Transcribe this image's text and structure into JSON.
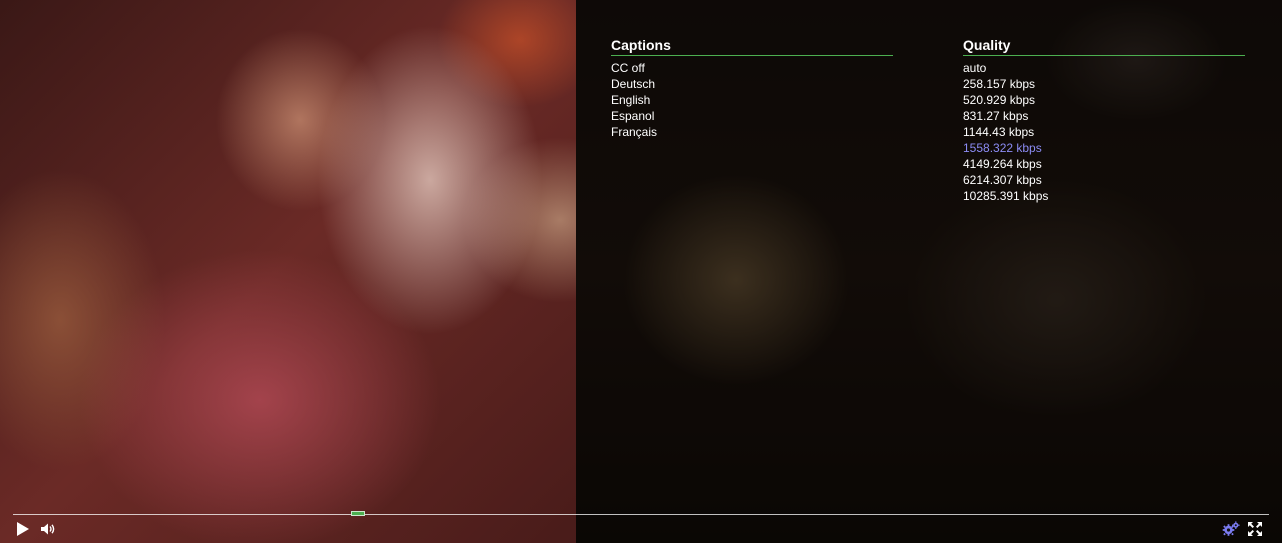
{
  "player": {
    "progress_fraction": 0.275
  },
  "captions": {
    "heading": "Captions",
    "items": [
      "CC off",
      "Deutsch",
      "English",
      "Espanol",
      "Français"
    ]
  },
  "quality": {
    "heading": "Quality",
    "items": [
      "auto",
      "258.157 kbps",
      "520.929 kbps",
      "831.27 kbps",
      "1144.43 kbps",
      "1558.322 kbps",
      "4149.264 kbps",
      "6214.307 kbps",
      "10285.391 kbps"
    ],
    "selected": "1558.322 kbps"
  },
  "controls": {
    "play_icon": "play-icon",
    "volume_icon": "volume-icon",
    "settings_icon": "gear-icon",
    "fullscreen_icon": "fullscreen-icon"
  },
  "colors": {
    "accent_green": "#4caf50",
    "selected_item": "#8c8cf4",
    "settings_icon": "#7b7bf0"
  }
}
